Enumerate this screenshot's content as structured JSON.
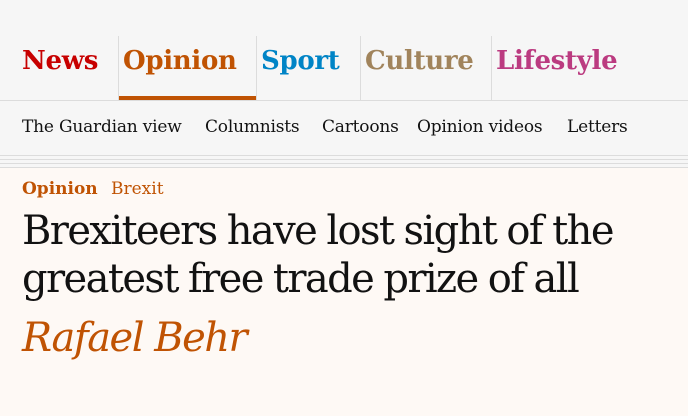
{
  "pillars": [
    {
      "label": "News",
      "color": "#c70000",
      "selected": false
    },
    {
      "label": "Opinion",
      "color": "#c05303",
      "selected": true
    },
    {
      "label": "Sport",
      "color": "#0084c6",
      "selected": false
    },
    {
      "label": "Culture",
      "color": "#a1845c",
      "selected": false
    },
    {
      "label": "Lifestyle",
      "color": "#bb3b80",
      "selected": false
    }
  ],
  "subnav": [
    "The Guardian view",
    "Columnists",
    "Cartoons",
    "Opinion videos",
    "Letters"
  ],
  "article": {
    "section": "Opinion",
    "series": "Brexit",
    "headline": "Brexiteers have lost sight of the greatest free trade prize of all",
    "byline": "Rafael Behr"
  },
  "colors": {
    "opinion_accent": "#c05303",
    "background": "#fef9f5",
    "nav_background": "#f6f6f6"
  }
}
